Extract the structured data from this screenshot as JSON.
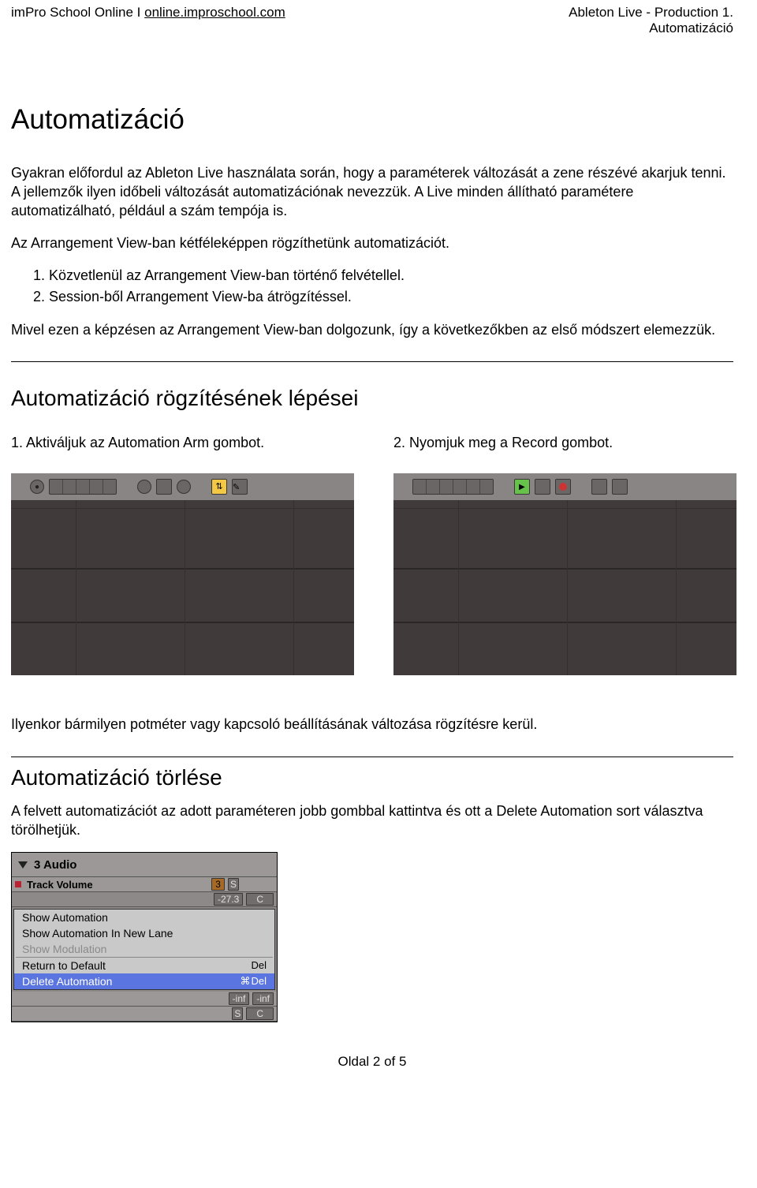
{
  "header": {
    "left_plain": "imPro School Online I ",
    "left_link": "online.improschool.com",
    "right_line1": "Ableton Live - Production 1.",
    "right_line2": "Automatizáció"
  },
  "title": "Automatizáció",
  "para1": "Gyakran előfordul az Ableton Live használata során, hogy a paraméterek változását a zene részévé akarjuk tenni. A jellemzők ilyen időbeli változását automatizációnak nevezzük. A Live minden állítható paramétere automatizálható, például a szám tempója is.",
  "para2_intro": "Az Arrangement View-ban kétféleképpen rögzíthetünk automatizációt.",
  "list": {
    "item1": "1.  Közvetlenül az Arrangement View-ban történő felvétellel.",
    "item2": "2.  Session-ből Arrangement View-ba átrögzítéssel."
  },
  "para3": "Mivel ezen a képzésen az Arrangement View-ban dolgozunk, így a következőkben az első módszert elemezzük.",
  "section2": "Automatizáció rögzítésének lépései",
  "steps": {
    "left": "1. Aktiváljuk az Automation Arm gombot.",
    "right": "2. Nyomjuk meg a Record gombot."
  },
  "para4": "Ilyenkor bármilyen potméter vagy kapcsoló beállításának változása rögzítésre kerül.",
  "section3": "Automatizáció törlése",
  "para5": "A felvett automatizációt az adott paraméteren jobb gombbal kattintva és ott a Delete Automation sort választva törölhetjük.",
  "ctx": {
    "track_label": "3 Audio",
    "row2_label": "Track Volume",
    "row2_num_a": "3",
    "row2_num_b": "-27.3",
    "s": "S",
    "c": "C",
    "inf": "-inf",
    "menu": {
      "m1": "Show Automation",
      "m2": "Show Automation In New Lane",
      "m3": "Show Modulation",
      "m4": "Return to Default",
      "m4_short": "Del",
      "m5": "Delete Automation",
      "m5_short": "Del"
    }
  },
  "footer": "Oldal 2 of 5"
}
